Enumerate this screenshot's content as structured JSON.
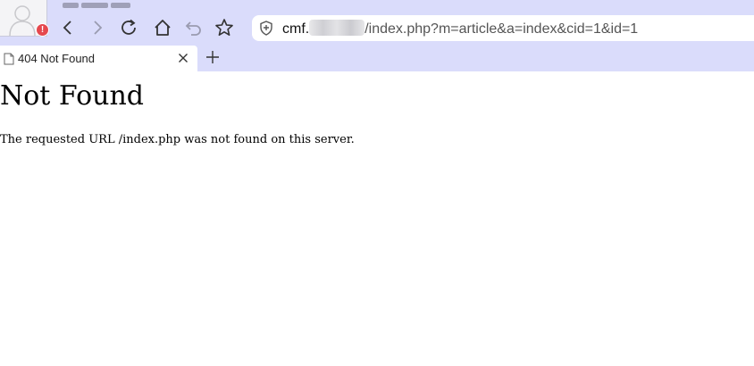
{
  "browser": {
    "toolbar": {
      "buttons": [
        "back",
        "forward",
        "reload",
        "home",
        "undo",
        "favorite"
      ],
      "alert_badge": "!"
    },
    "address_bar": {
      "url_prefix": "cmf.",
      "url_suffix": "/index.php?m=article&a=index&cid=1&id=1"
    },
    "tabs": [
      {
        "title": "404 Not Found",
        "active": true
      }
    ]
  },
  "page": {
    "heading": "Not Found",
    "message": "The requested URL /index.php was not found on this server."
  },
  "colors": {
    "chrome_bg": "#dadcfb",
    "alert": "#e5484d"
  }
}
